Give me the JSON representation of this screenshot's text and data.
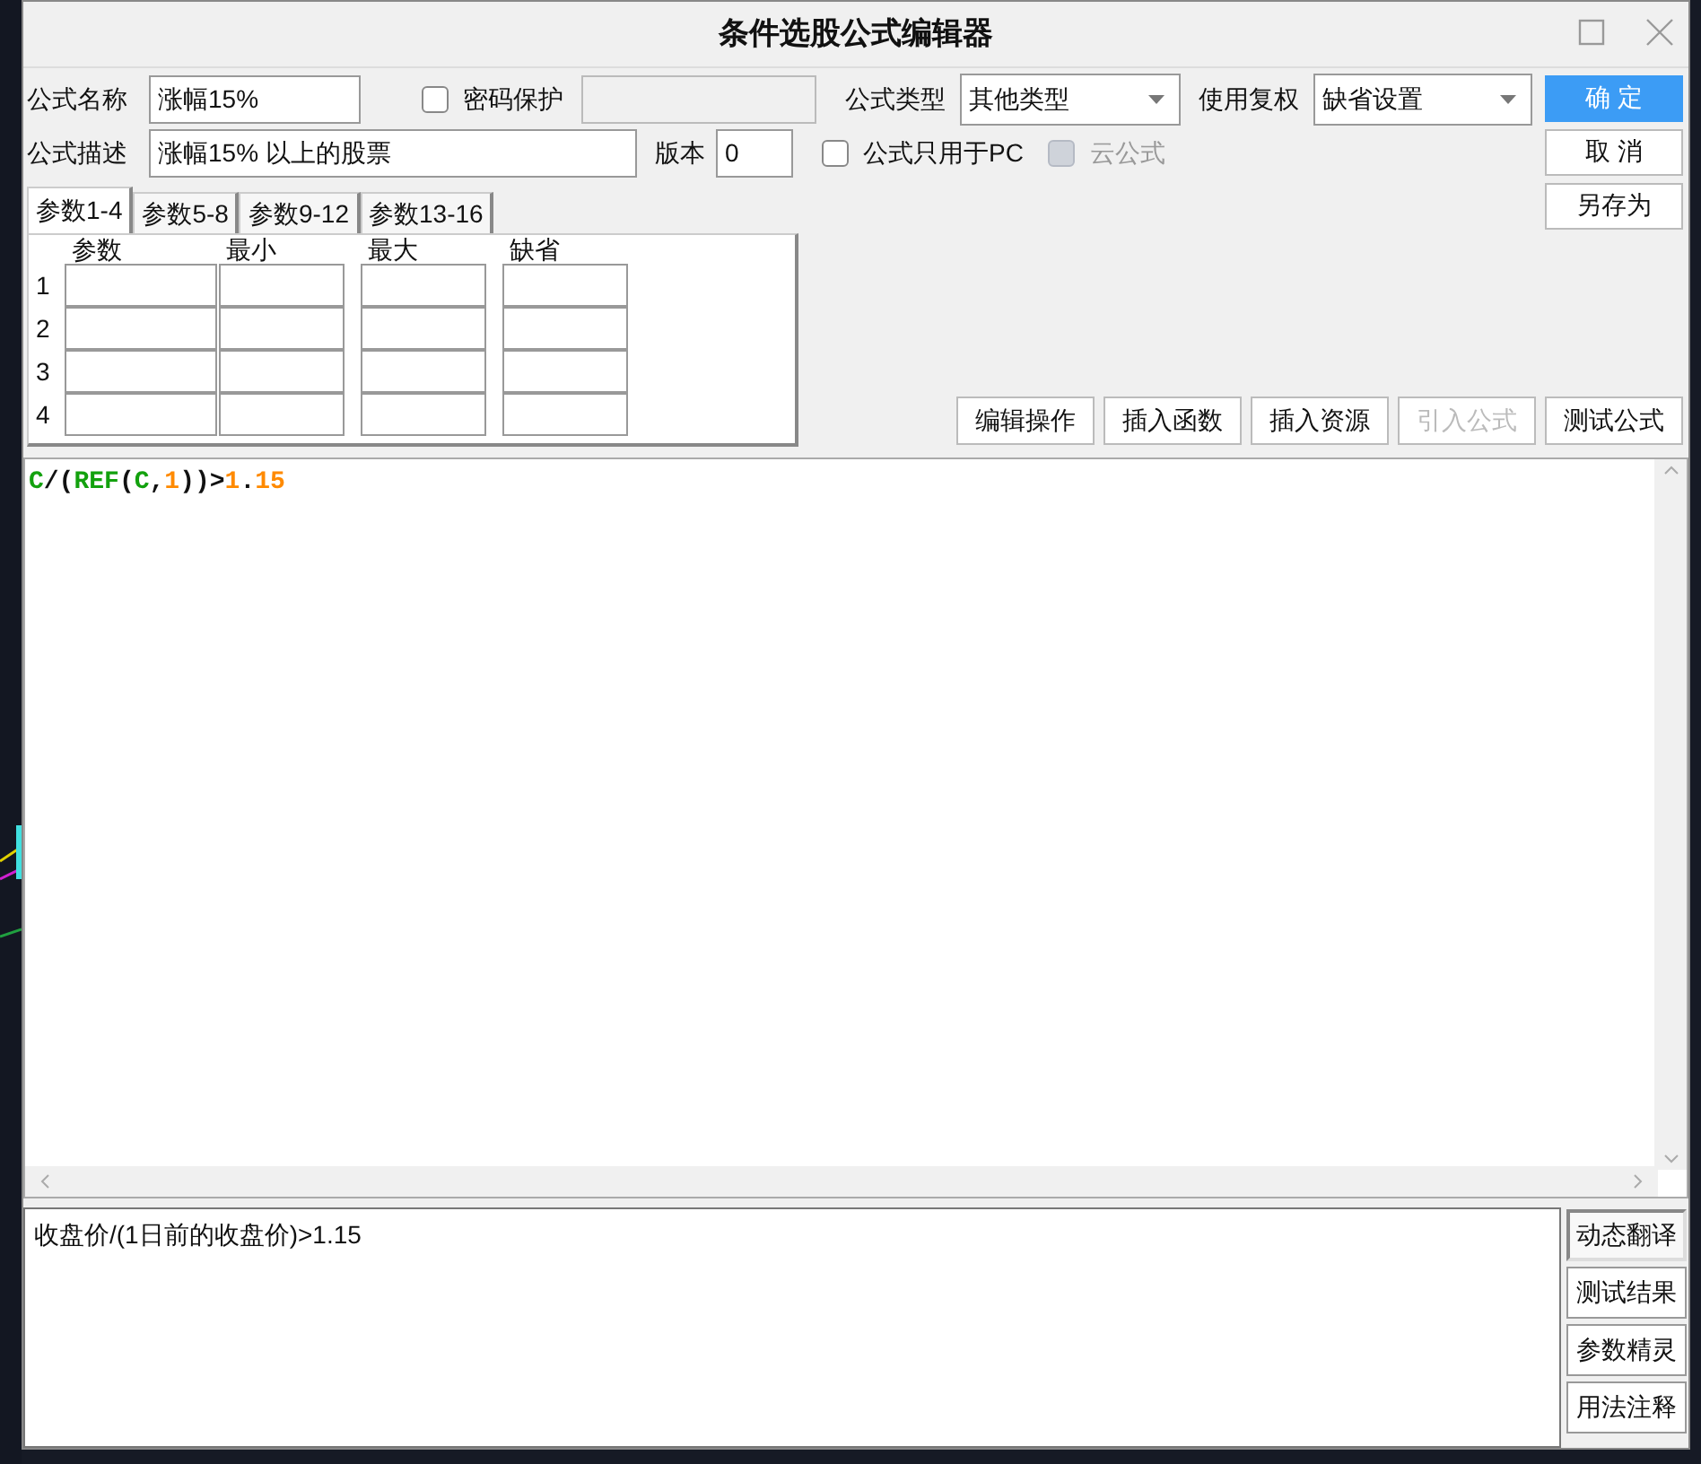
{
  "window": {
    "title": "条件选股公式编辑器"
  },
  "formula_name": {
    "label": "公式名称",
    "value": "涨幅15%"
  },
  "password_protect": {
    "label": "密码保护",
    "checked": false
  },
  "formula_type": {
    "label": "公式类型",
    "value": "其他类型"
  },
  "price_adjust": {
    "label": "使用复权",
    "value": "缺省设置"
  },
  "description": {
    "label": "公式描述",
    "value": "涨幅15% 以上的股票"
  },
  "version": {
    "label": "版本",
    "value": "0"
  },
  "pc_only": {
    "label": "公式只用于PC",
    "checked": false,
    "disabled": false
  },
  "cloud_formula": {
    "label": "云公式",
    "checked": false,
    "disabled": true
  },
  "param_tabs": [
    {
      "label": "参数1-4",
      "selected": true
    },
    {
      "label": "参数5-8",
      "selected": false
    },
    {
      "label": "参数9-12",
      "selected": false
    },
    {
      "label": "参数13-16",
      "selected": false
    }
  ],
  "param_table": {
    "columns": [
      "参数",
      "最小",
      "最大",
      "缺省"
    ],
    "rows": [
      "1",
      "2",
      "3",
      "4"
    ]
  },
  "side_buttons": [
    {
      "label": "确 定",
      "primary": true
    },
    {
      "label": "取 消",
      "primary": false
    },
    {
      "label": "另存为",
      "primary": false
    }
  ],
  "action_buttons": [
    {
      "label": "编辑操作",
      "disabled": false
    },
    {
      "label": "插入函数",
      "disabled": false
    },
    {
      "label": "插入资源",
      "disabled": false
    },
    {
      "label": "引入公式",
      "disabled": true
    },
    {
      "label": "测试公式",
      "disabled": false
    }
  ],
  "code": [
    {
      "text": "C",
      "kind": "ident"
    },
    {
      "text": "/(",
      "kind": "punct"
    },
    {
      "text": "REF",
      "kind": "ident"
    },
    {
      "text": "(",
      "kind": "punct"
    },
    {
      "text": "C",
      "kind": "ident"
    },
    {
      "text": ",",
      "kind": "punct"
    },
    {
      "text": "1",
      "kind": "number"
    },
    {
      "text": "))>",
      "kind": "punct"
    },
    {
      "text": "1",
      "kind": "number"
    },
    {
      "text": ".",
      "kind": "punct"
    },
    {
      "text": "15",
      "kind": "number"
    }
  ],
  "translation": {
    "text": "收盘价/(1日前的收盘价)>1.15"
  },
  "tool_buttons": [
    {
      "label": "动态翻译",
      "pressed": true
    },
    {
      "label": "测试结果",
      "pressed": false
    },
    {
      "label": "参数精灵",
      "pressed": false
    },
    {
      "label": "用法注释",
      "pressed": false
    }
  ]
}
